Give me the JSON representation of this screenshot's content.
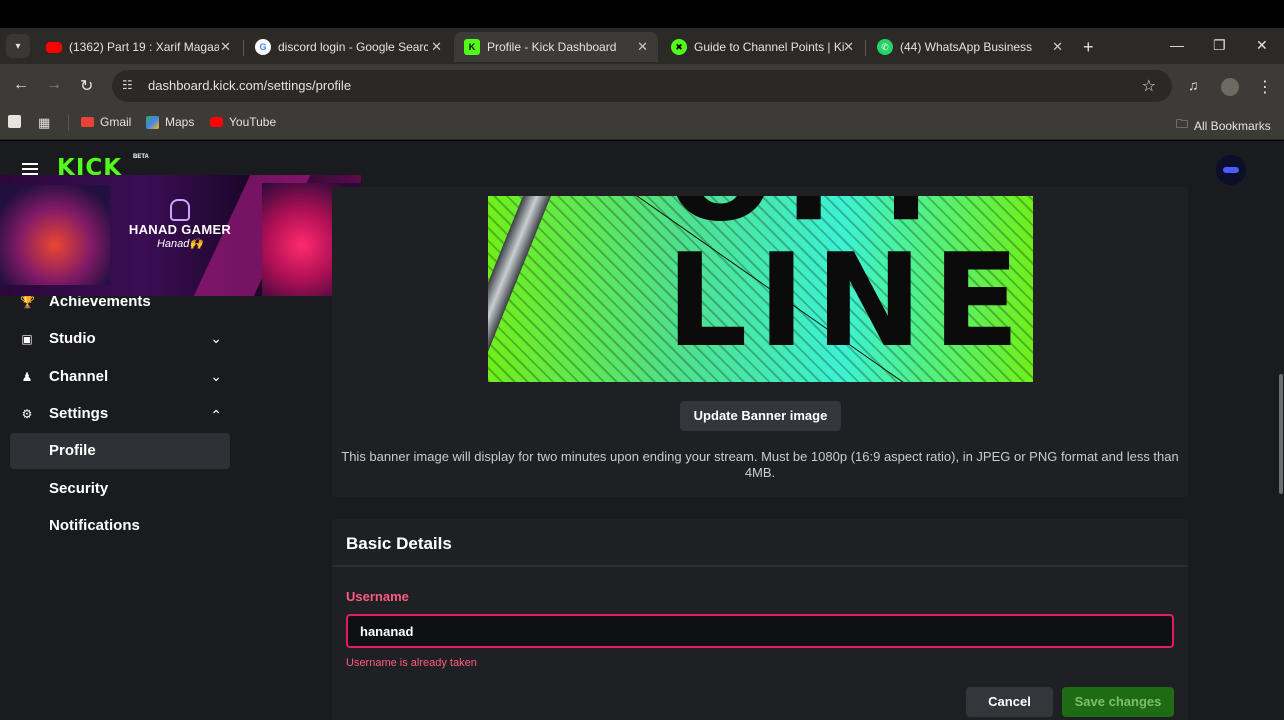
{
  "browser": {
    "tabs": [
      {
        "title": "(1362) Part 19 : Xarif Magaa",
        "favicon": "youtube-icon",
        "color": "#ff0000"
      },
      {
        "title": "discord login - Google Searc",
        "favicon": "google-icon",
        "color": "#ffffff"
      },
      {
        "title": "Profile - Kick Dashboard",
        "favicon": "kick-icon",
        "color": "#53fc18",
        "active": true
      },
      {
        "title": "Guide to Channel Points | Ki",
        "favicon": "kick-icon",
        "color": "#53fc18"
      },
      {
        "title": "(44) WhatsApp Business",
        "favicon": "whatsapp-icon",
        "color": "#25d366"
      }
    ],
    "url": "dashboard.kick.com/settings/profile",
    "bookmarks": [
      {
        "label": "Gmail",
        "icon": "gmail-icon"
      },
      {
        "label": "Maps",
        "icon": "maps-icon"
      },
      {
        "label": "YouTube",
        "icon": "youtube-icon"
      }
    ],
    "all_bookmarks": "All Bookmarks"
  },
  "app": {
    "logo": "KICK",
    "beta": "BETA",
    "accent": "#53fc18"
  },
  "webcam": {
    "name": "HANAD GAMER",
    "sub": "Hanad🙌"
  },
  "sidebar": {
    "items": [
      {
        "label": "Achievements",
        "icon": "trophy-icon"
      },
      {
        "label": "Studio",
        "icon": "studio-icon",
        "expanded": false
      },
      {
        "label": "Channel",
        "icon": "channel-icon",
        "expanded": false
      },
      {
        "label": "Settings",
        "icon": "gear-icon",
        "expanded": true
      },
      {
        "label": "Profile",
        "active": true
      },
      {
        "label": "Security"
      },
      {
        "label": "Notifications"
      }
    ]
  },
  "banner": {
    "image_text_top": "OFF",
    "image_text": "LINE",
    "update_button": "Update Banner image",
    "note": "This banner image will display for two minutes upon ending your stream. Must be 1080p (16:9 aspect ratio), in JPEG or PNG format and less than 4MB."
  },
  "details": {
    "title": "Basic Details",
    "username_label": "Username",
    "username_value": "hananad",
    "error": "Username is already taken",
    "cancel": "Cancel",
    "save": "Save changes",
    "error_color": "#e01e5a"
  }
}
